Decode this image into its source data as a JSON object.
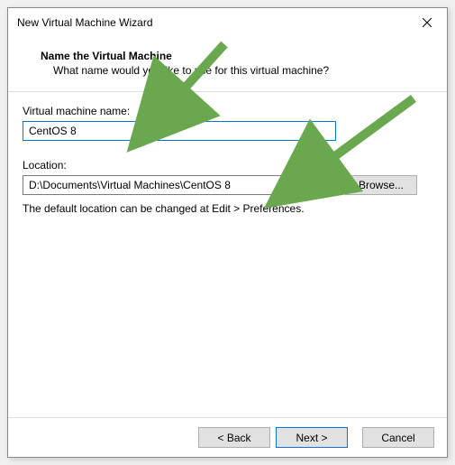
{
  "window": {
    "title": "New Virtual Machine Wizard"
  },
  "header": {
    "title": "Name the Virtual Machine",
    "subtitle": "What name would you like to use for this virtual machine?"
  },
  "fields": {
    "vm_name_label": "Virtual machine name:",
    "vm_name_value": "CentOS 8",
    "location_label": "Location:",
    "location_value": "D:\\Documents\\Virtual Machines\\CentOS 8",
    "browse_label": "Browse...",
    "hint": "The default location can be changed at Edit > Preferences."
  },
  "buttons": {
    "back": "< Back",
    "next": "Next >",
    "cancel": "Cancel"
  }
}
